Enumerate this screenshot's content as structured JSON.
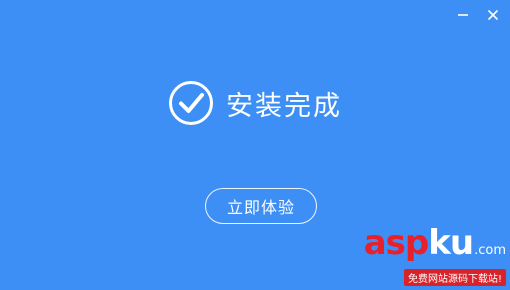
{
  "window": {
    "background": "#3d8ff5",
    "controls": [
      {
        "icon": "minimize-icon"
      },
      {
        "icon": "close-icon"
      }
    ]
  },
  "status": {
    "icon": "check-circle-icon",
    "text": "安装完成"
  },
  "action": {
    "button_label": "立即体验"
  },
  "watermark": {
    "logo_red": "asp",
    "logo_white": "ku",
    "logo_suffix": ".com",
    "subtitle": "免费网站源码下载站!",
    "red": "#e8202a"
  }
}
